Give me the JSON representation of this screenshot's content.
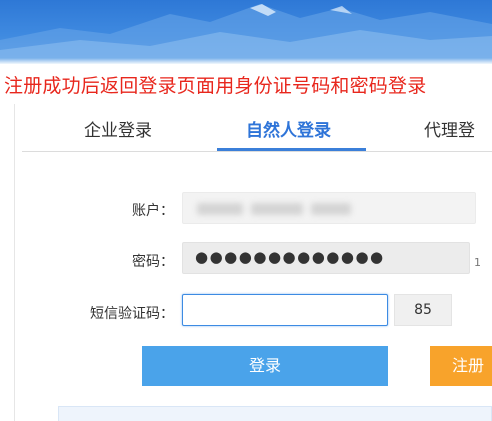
{
  "notice": {
    "text": "注册成功后返回登录页面用身份证号码和密码登录"
  },
  "tabs": [
    {
      "label": "企业登录",
      "active": false
    },
    {
      "label": "自然人登录",
      "active": true
    },
    {
      "label": "代理登",
      "active": false
    }
  ],
  "form": {
    "account_label": "账户：",
    "account_value": "",
    "password_label": "密码：",
    "password_value": "●●●●●●●●●●●●●",
    "sms_label": "短信验证码：",
    "sms_value": "",
    "captcha_text": "85",
    "edge_char": "1"
  },
  "buttons": {
    "login_label": "登录",
    "register_label": "注册"
  },
  "colors": {
    "notice": "#e8271d",
    "active_tab": "#2e74d8",
    "login_button": "#4aa3ea",
    "register_button": "#f8a32b",
    "banner": "#3f8ae0"
  }
}
